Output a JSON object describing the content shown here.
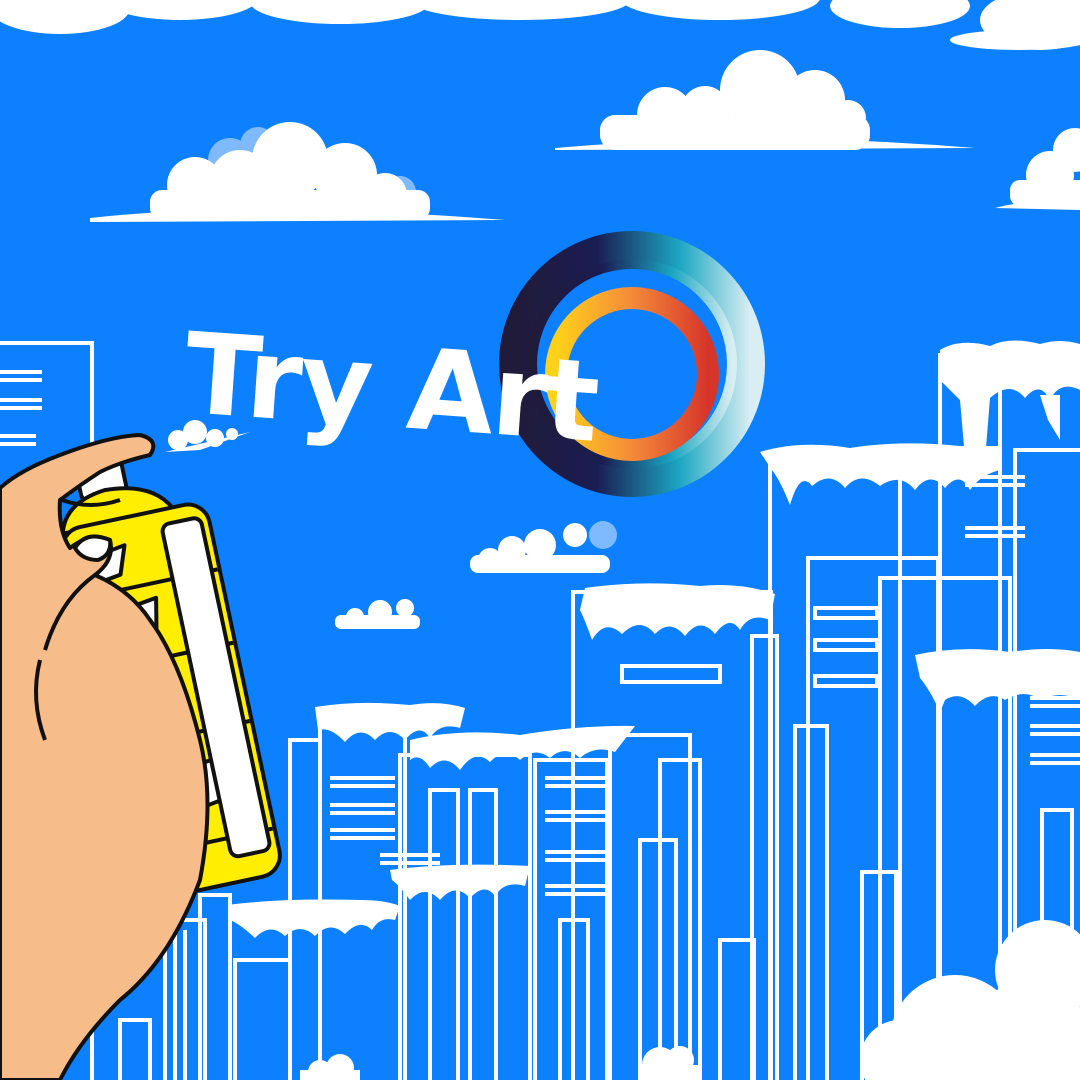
{
  "title": "Try Art",
  "colors": {
    "sky": "#0d80ff",
    "cloud": "#ffffff",
    "cloud_shadow": "#7fbaff",
    "can_body": "#ffee00",
    "skin": "#f6bc8a",
    "outline": "#111111",
    "ring_outer_start": "#211b3a",
    "ring_outer_end": "#1aa6c2",
    "ring_inner_start": "#ffd21a",
    "ring_inner_end": "#d6352a"
  },
  "icons": {
    "logo": "gradient-ring-logo",
    "hand": "hand-holding-spray-can",
    "spray": "spray-can-icon"
  }
}
